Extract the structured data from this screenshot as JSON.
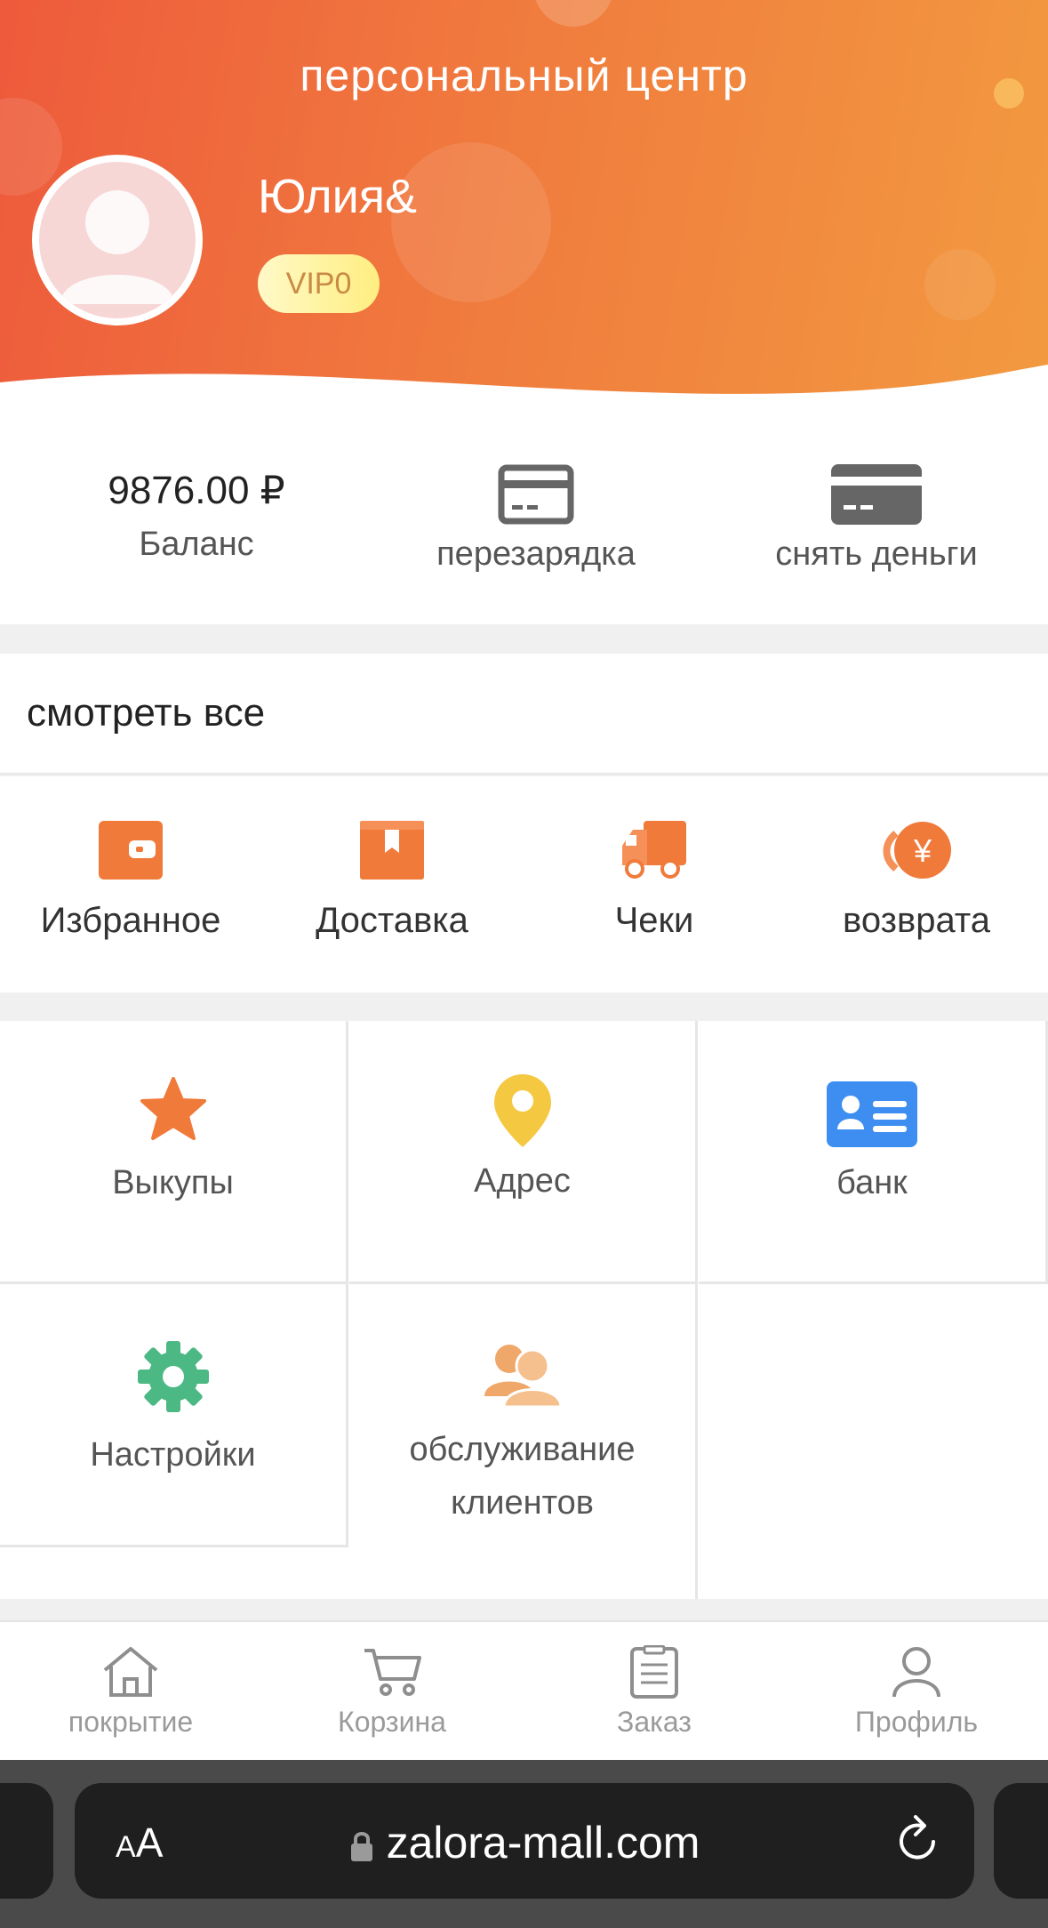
{
  "header": {
    "title": "персональный центр",
    "username": "Юлия&",
    "vip_badge": "VIP0"
  },
  "stats": {
    "balance_value": "9876.00 ₽",
    "balance_label": "Баланс",
    "recharge_label": "перезарядка",
    "withdraw_label": "снять деньги"
  },
  "orders": {
    "view_all": "смотреть все",
    "items": [
      {
        "label": "Избранное",
        "icon": "wallet-icon"
      },
      {
        "label": "Доставка",
        "icon": "box-icon"
      },
      {
        "label": "Чеки",
        "icon": "truck-icon"
      },
      {
        "label": "возврата",
        "icon": "refund-yen-icon"
      }
    ]
  },
  "grid": {
    "items": [
      {
        "label": "Выкупы",
        "icon": "star-icon"
      },
      {
        "label": "Адрес",
        "icon": "location-pin-icon"
      },
      {
        "label": "банк",
        "icon": "id-card-icon"
      },
      {
        "label": "Настройки",
        "icon": "gear-icon"
      },
      {
        "label_line1": "обслуживание",
        "label_line2": "клиентов",
        "icon": "customer-service-icon"
      }
    ]
  },
  "tabbar": {
    "items": [
      {
        "label": "покрытие",
        "icon": "home-icon"
      },
      {
        "label": "Корзина",
        "icon": "cart-icon"
      },
      {
        "label": "Заказ",
        "icon": "clipboard-icon"
      },
      {
        "label": "Профиль",
        "icon": "user-icon"
      }
    ]
  },
  "browser": {
    "text_size_small": "A",
    "text_size_large": "A",
    "url": "zalora-mall.com"
  },
  "colors": {
    "header_start": "#ee5a3c",
    "header_end": "#f29a40",
    "orange_icon": "#f07a3a",
    "star": "#f07a3a",
    "pin": "#f5c842",
    "bank_card": "#3d8ef0",
    "gear": "#4cb884",
    "service": "#f0a86a"
  }
}
